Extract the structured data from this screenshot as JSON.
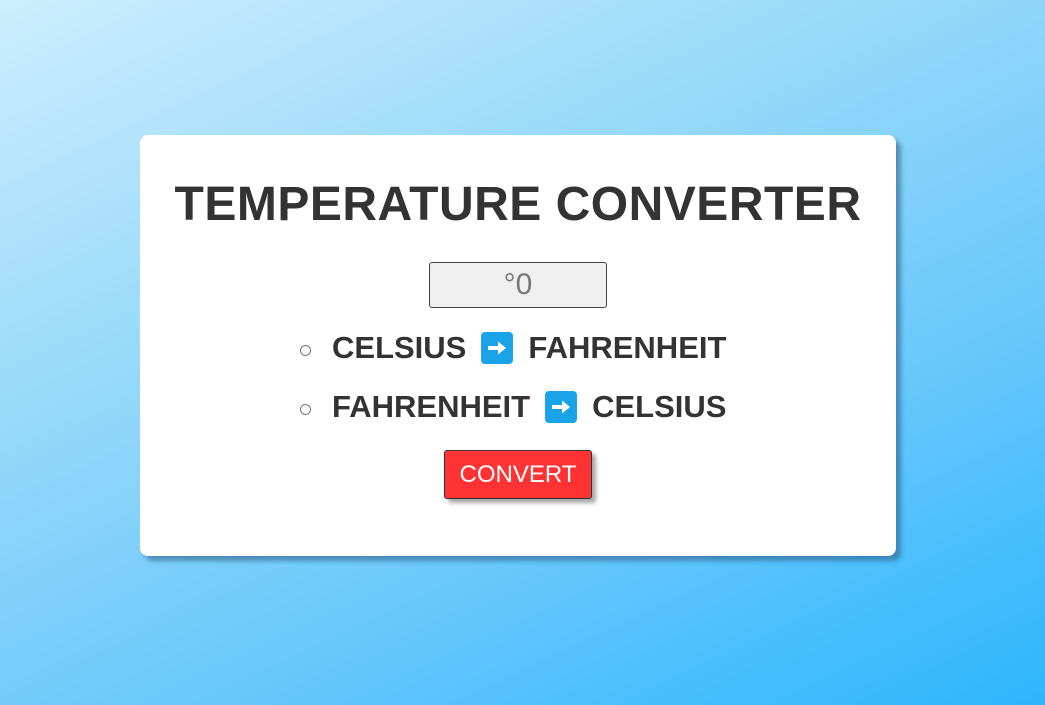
{
  "converter": {
    "title": "TEMPERATURE CONVERTER",
    "input": {
      "placeholder": "°0",
      "value": ""
    },
    "options": [
      {
        "from": "CELSIUS",
        "to": "FAHRENHEIT",
        "arrow_icon": "right-arrow-icon"
      },
      {
        "from": "FAHRENHEIT",
        "to": "CELSIUS",
        "arrow_icon": "right-arrow-icon"
      }
    ],
    "convert_label": "CONVERT"
  },
  "colors": {
    "button_bg": "#ff3333",
    "arrow_bg": "#1aa3e8",
    "text": "#333333",
    "background_start": "#cdeefd",
    "background_end": "#2db6fd"
  }
}
